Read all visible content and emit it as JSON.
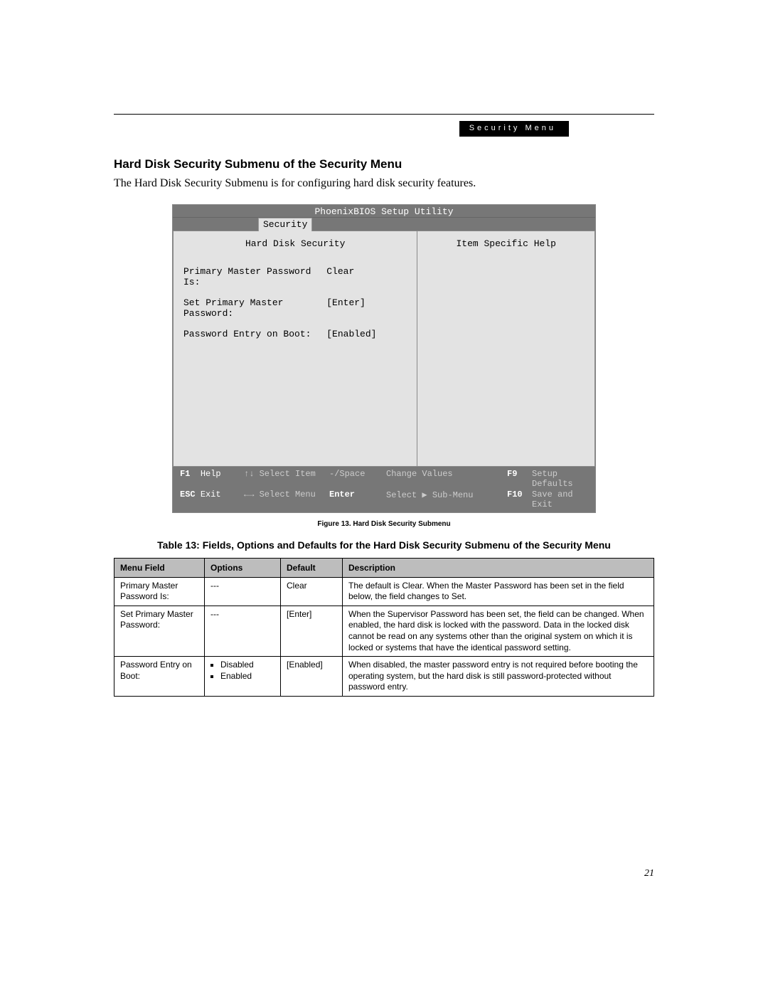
{
  "header_badge": "Security Menu",
  "section_title": "Hard Disk Security Submenu of the Security Menu",
  "intro": "The Hard Disk Security Submenu is for configuring hard disk security features.",
  "bios": {
    "title": "PhoenixBIOS Setup Utility",
    "tab": "Security",
    "left_head": "Hard Disk Security",
    "right_head": "Item Specific Help",
    "rows": [
      {
        "label": "Primary Master Password Is:",
        "value": "Clear"
      },
      {
        "label": "Set Primary Master Password:",
        "value": "[Enter]"
      },
      {
        "label": "Password Entry on Boot:",
        "value": "[Enabled]"
      }
    ],
    "footer": {
      "f1": "F1",
      "f1_label": "Help",
      "updown": "↑↓",
      "updown_label": "Select Item",
      "space": "-/Space",
      "space_label": "Change Values",
      "f9": "F9",
      "f9_label": "Setup Defaults",
      "esc": "ESC",
      "esc_label": "Exit",
      "lr": "←→",
      "lr_label": "Select Menu",
      "enter": "Enter",
      "enter_label": "Select ▶ Sub-Menu",
      "f10": "F10",
      "f10_label": "Save and Exit"
    }
  },
  "figure_caption": "Figure 13.  Hard Disk Security Submenu",
  "table_title": "Table 13: Fields, Options and Defaults for the Hard Disk Security Submenu of the Security Menu",
  "table": {
    "headers": {
      "menu": "Menu Field",
      "options": "Options",
      "default": "Default",
      "desc": "Description"
    },
    "rows": [
      {
        "menu": "Primary Master Password Is:",
        "options": [
          "---"
        ],
        "default": "Clear",
        "desc": "The default is Clear. When the Master Password has been set in the field below, the field changes to Set."
      },
      {
        "menu": "Set Primary Master Password:",
        "options": [
          "---"
        ],
        "default": "[Enter]",
        "desc": "When the Supervisor Password has been set, the field can be changed. When enabled, the hard disk is locked with the password. Data in the locked disk cannot be read on any systems other than the original system on which it is locked or systems that have the identical password setting."
      },
      {
        "menu": "Password Entry on Boot:",
        "options": [
          "Disabled",
          "Enabled"
        ],
        "default": "[Enabled]",
        "desc": "When disabled, the master password entry is not required before booting the operating system, but the hard disk is still password-protected without password entry."
      }
    ]
  },
  "page_number": "21"
}
